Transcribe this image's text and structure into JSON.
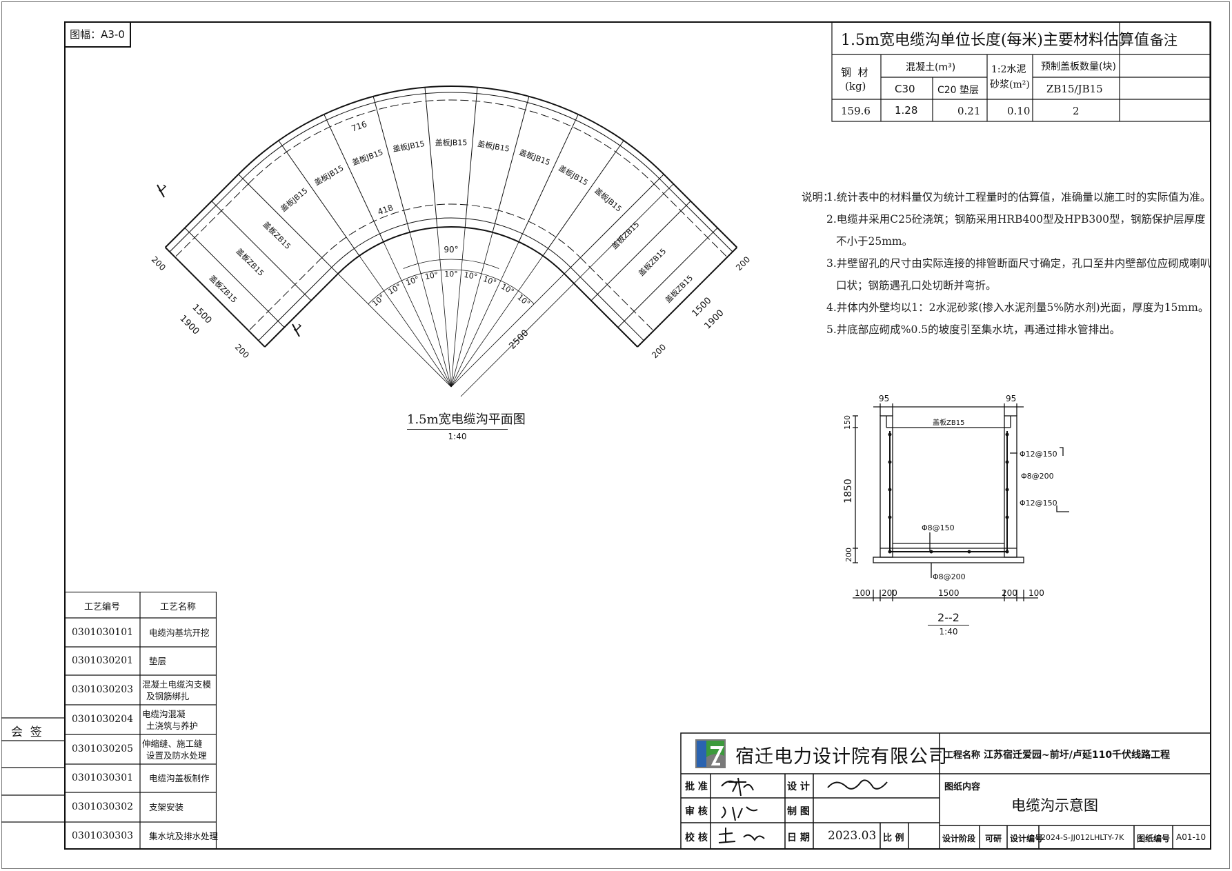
{
  "sheet": {
    "size_label": "图幅：A3-0"
  },
  "material_table": {
    "title": "1.5m宽电缆沟单位长度(每米)主要材料估算值",
    "remark_header": "备注",
    "steel_header_1": "钢  材",
    "steel_header_2": "(kg)",
    "concrete_header": "混凝土(m³)",
    "c30_header": "C30",
    "c20_header": "C20 垫层",
    "mortar_header_1": "1:2水泥",
    "mortar_header_2": "砂浆(m²)",
    "cover_header": "预制盖板数量(块)",
    "cover_sub_header": "ZB15/JB15",
    "values": {
      "steel": "159.6",
      "c30": "1.28",
      "c20": "0.21",
      "mortar": "0.10",
      "cover": "2"
    }
  },
  "notes": {
    "lead": "说明：",
    "lines": [
      "1.统计表中的材料量仅为统计工程量时的估算值，准确量以施工时的实际值为准。",
      "2.电缆井采用C25砼浇筑；钢筋采用HRB400型及HPB300型，钢筋保护层厚度",
      "不小于25mm。",
      "3.井壁留孔的尺寸由实际连接的排管断面尺寸确定，孔口至井内壁部位应砌成喇叭",
      "口状；钢筋遇孔口处切断并弯折。",
      "4.井体内外壁均以1：2水泥砂浆(掺入水泥剂量5%防水剂)光面，厚度为15mm。",
      "5.井底部应砌成%0.5的坡度引至集水坑，再通过排水管排出。"
    ]
  },
  "plan_view": {
    "title": "1.5m宽电缆沟平面图",
    "scale": "1:40",
    "dim_716": "716",
    "dim_418": "418",
    "dim_90": "90°",
    "dim_10": "10°",
    "dim_2500": "2500",
    "dim_1500": "1500",
    "dim_1900": "1900",
    "dim_200": "200",
    "section_mark": "1",
    "cover_zb": "盖板ZB15",
    "cover_jb": "盖板JB15"
  },
  "section_view": {
    "title": "2--2",
    "scale": "1:40",
    "dim_95": "95",
    "dim_150": "150",
    "dim_1850": "1850",
    "dim_200": "200",
    "dim_100": "100",
    "dim_1500": "1500",
    "cover_label": "盖板ZB15",
    "rebar_1": "Φ12@150",
    "rebar_2": "Φ8@200",
    "rebar_3": "Φ12@150",
    "rebar_4": "Φ8@150",
    "rebar_5": "Φ8@200"
  },
  "process_table": {
    "header_code": "工艺编号",
    "header_name": "工艺名称",
    "rows": [
      {
        "code": "0301030101",
        "name_1": "电缆沟基坑开挖",
        "name_2": ""
      },
      {
        "code": "0301030201",
        "name_1": "垫层",
        "name_2": ""
      },
      {
        "code": "0301030203",
        "name_1": "混凝土电缆沟支模",
        "name_2": "及钢筋绑扎"
      },
      {
        "code": "0301030204",
        "name_1": "电缆沟混凝",
        "name_2": "土浇筑与养护"
      },
      {
        "code": "0301030205",
        "name_1": "伸缩缝、施工缝",
        "name_2": "设置及防水处理"
      },
      {
        "code": "0301030301",
        "name_1": "电缆沟盖板制作",
        "name_2": ""
      },
      {
        "code": "0301030302",
        "name_1": "支架安装",
        "name_2": ""
      },
      {
        "code": "0301030303",
        "name_1": "集水坑及排水处理",
        "name_2": ""
      }
    ]
  },
  "sign_box": {
    "label": "会  签"
  },
  "title_block": {
    "company": "宿迁电力设计院有限公司",
    "project_label": "工程名称",
    "project_name": "江苏宿迁爱园~前圩/卢延110千伏线路工程",
    "approve_label": "批 准",
    "design_label": "设 计",
    "review_label": "审 核",
    "draw_label": "制 图",
    "check_label": "校 核",
    "date_label": "日 期",
    "date_value": "2023.03",
    "ratio_label": "比 例",
    "content_label": "图纸内容",
    "content_value": "电缆沟示意图",
    "stage_label": "设计阶段",
    "stage_value": "可研",
    "design_no_label": "设计编号",
    "design_no_value": "2024-S-JJ012LHLTY-7K",
    "drawing_no_label": "图纸编号",
    "drawing_no_value": "A01-10"
  },
  "colors": {
    "line": "#111111",
    "logo_blue": "#2a63b0",
    "logo_green": "#3c9a3c",
    "logo_gray": "#7a7a7a"
  }
}
